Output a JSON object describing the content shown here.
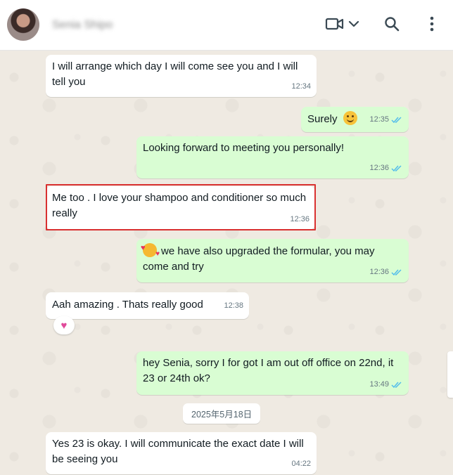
{
  "header": {
    "contact_name": "Senia Shipo",
    "icons": [
      "video-call-icon",
      "chevron-down-icon",
      "search-icon",
      "more-vertical-icon"
    ]
  },
  "messages": [
    {
      "direction": "in",
      "text": "I will arrange which day I will come see you and I will tell you",
      "time": "12:34"
    },
    {
      "direction": "out",
      "text": "Surely",
      "emoji": "smiling-face-emoji",
      "time": "12:35",
      "status": "read"
    },
    {
      "direction": "out",
      "text": "Looking forward to meeting you personally!",
      "time": "12:36",
      "status": "read"
    },
    {
      "direction": "in",
      "text": "Me too . I love your shampoo and conditioner so much really",
      "time": "12:36",
      "highlighted": true
    },
    {
      "direction": "out",
      "text": "we have also upgraded the formular, you may come and try",
      "emoji": "smiling-face-with-hearts-emoji",
      "time": "12:36",
      "status": "read"
    },
    {
      "direction": "in",
      "text": "Aah amazing . Thats really good",
      "time": "12:38",
      "reaction": "pink-heart-emoji"
    },
    {
      "direction": "out",
      "text": "hey Senia, sorry I for got I am out off office on 22nd, it 23 or 24th ok?",
      "time": "13:49",
      "status": "read"
    },
    {
      "direction": "in",
      "text": "Yes 23 is okay. I will communicate the exact date I will be seeing you",
      "time": "04:22"
    }
  ],
  "date_separator": "2025年5月18日",
  "colors": {
    "incoming_bubble": "#ffffff",
    "outgoing_bubble": "#d9fdd3",
    "read_ticks": "#53bdeb",
    "highlight_border": "#d93030",
    "background": "#efeae2"
  }
}
